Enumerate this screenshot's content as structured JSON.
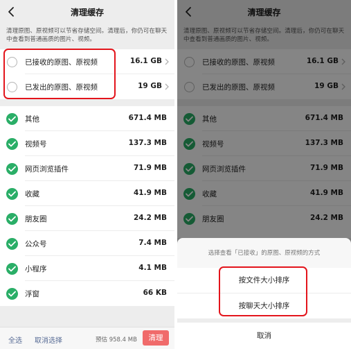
{
  "colors": {
    "check_green": "#2aae67",
    "highlight_red": "#e3141b",
    "link_blue": "#576b95",
    "clean_button": "#f06b6b"
  },
  "left": {
    "nav": {
      "back_icon": "chevron-left-icon",
      "title": "清理缓存"
    },
    "description": "清理原图、原视频可以节省存储空间。清理后，你仍可在聊天中查看到普通画质的图片、视频。",
    "media_rows": [
      {
        "label": "已接收的原图、原视频",
        "size": "16.1 GB",
        "checked": false
      },
      {
        "label": "已发出的原图、原视频",
        "size": "19 GB",
        "checked": false
      }
    ],
    "items": [
      {
        "label": "其他",
        "size": "671.4 MB",
        "checked": true
      },
      {
        "label": "视频号",
        "size": "137.3 MB",
        "checked": true
      },
      {
        "label": "网页浏览插件",
        "size": "71.9 MB",
        "checked": true
      },
      {
        "label": "收藏",
        "size": "41.9 MB",
        "checked": true
      },
      {
        "label": "朋友圈",
        "size": "24.2 MB",
        "checked": true
      },
      {
        "label": "公众号",
        "size": "7.4 MB",
        "checked": true
      },
      {
        "label": "小程序",
        "size": "4.1 MB",
        "checked": true
      },
      {
        "label": "浮窗",
        "size": "66 KB",
        "checked": true
      }
    ],
    "bottom_bar": {
      "select_all": "全选",
      "deselect": "取消选择",
      "estimate": "预估 958.4 MB",
      "clean": "清理"
    }
  },
  "right": {
    "nav": {
      "back_icon": "chevron-left-icon",
      "title": "清理缓存"
    },
    "description": "清理原图、原视频可以节省存储空间。清理后，你仍可在聊天中查看到普通画质的图片、视频。",
    "media_rows": [
      {
        "label": "已接收的原图、原视频",
        "size": "16.1 GB",
        "checked": false
      },
      {
        "label": "已发出的原图、原视频",
        "size": "19 GB",
        "checked": false
      }
    ],
    "items": [
      {
        "label": "其他",
        "size": "671.4 MB",
        "checked": true
      },
      {
        "label": "视频号",
        "size": "137.3 MB",
        "checked": true
      },
      {
        "label": "网页浏览插件",
        "size": "71.9 MB",
        "checked": true
      },
      {
        "label": "收藏",
        "size": "41.9 MB",
        "checked": true
      },
      {
        "label": "朋友圈",
        "size": "24.2 MB",
        "checked": true
      }
    ],
    "sheet": {
      "title": "选择查看「已接收」的原图、原视频的方式",
      "options": [
        "按文件大小排序",
        "按聊天大小排序"
      ],
      "cancel": "取消"
    }
  }
}
